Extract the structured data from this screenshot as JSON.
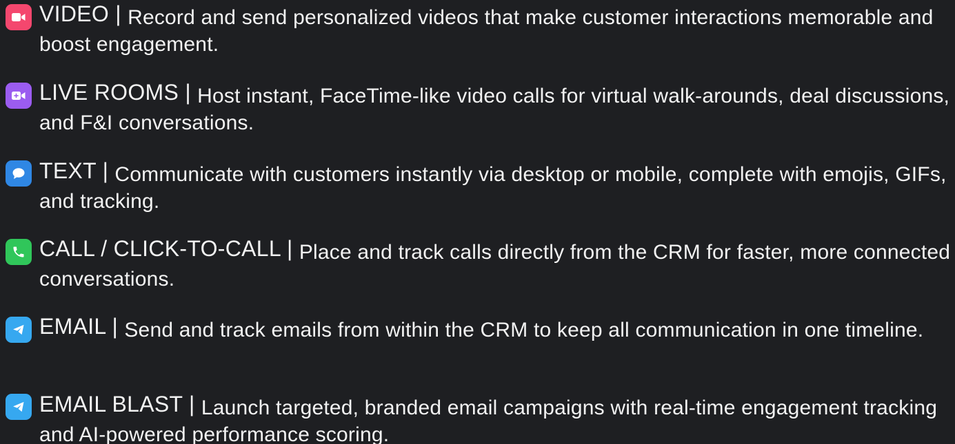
{
  "features": [
    {
      "icon": "video-camera-icon",
      "color": "#f4476e",
      "title": "VIDEO |",
      "description": "Record and send personalized videos that make customer interactions memorable and boost engagement."
    },
    {
      "icon": "live-room-icon",
      "color": "#9b5cf0",
      "title": "LIVE ROOMS |",
      "description": "Host instant, FaceTime-like video calls for virtual walk-arounds, deal discussions, and F&I conversations."
    },
    {
      "icon": "chat-bubble-icon",
      "color": "#2f87e4",
      "title": "TEXT |",
      "description": "Communicate with customers instantly via desktop or mobile, complete with emojis, GIFs, and tracking."
    },
    {
      "icon": "phone-icon",
      "color": "#30c65a",
      "title": "CALL / CLICK-TO-CALL |",
      "description": "Place and track calls directly from the CRM for faster, more connected conversations."
    },
    {
      "icon": "send-icon",
      "color": "#36a8f0",
      "title": "EMAIL |",
      "description": "Send and track emails from within the CRM to keep all communication in one timeline."
    },
    {
      "icon": "send-icon",
      "color": "#36a8f0",
      "title": "EMAIL BLAST |",
      "description": "Launch targeted, branded email campaigns with real-time engagement tracking and AI-powered performance scoring."
    }
  ]
}
